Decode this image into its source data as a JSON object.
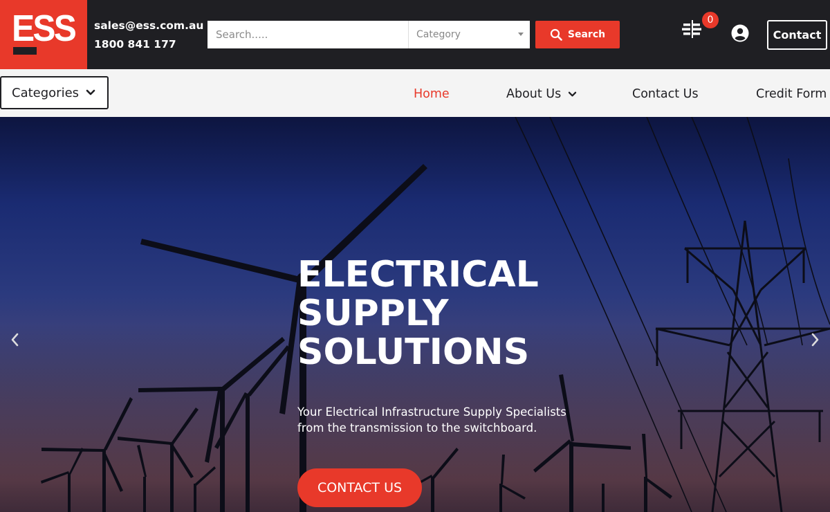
{
  "brand": {
    "logo_text": "ESS",
    "accent_color": "#e8392a",
    "dark_color": "#1f1f23"
  },
  "header": {
    "email": "sales@ess.com.au",
    "phone": "1800 841 177",
    "search_placeholder": "Search.....",
    "category_label": "Category",
    "search_button": "Search",
    "cart_count": "0",
    "contact_button": "Contact"
  },
  "nav": {
    "categories_label": "Categories",
    "items": [
      {
        "label": "Home",
        "active": true
      },
      {
        "label": "About Us",
        "dropdown": true
      },
      {
        "label": "Contact Us"
      },
      {
        "label": "Credit Form"
      }
    ]
  },
  "hero": {
    "title_lines": [
      "ELECTRICAL",
      "SUPPLY",
      "SOLUTIONS"
    ],
    "subtitle_lines": [
      "Your Electrical Infrastructure Supply Specialists",
      "from the transmission to the switchboard."
    ],
    "cta_label": "CONTACT US"
  },
  "icons": {
    "search": "search-icon",
    "compare": "compare-icon",
    "user": "user-icon",
    "chevron": "chevron-down-icon",
    "prev": "chevron-left-icon",
    "next": "chevron-right-icon"
  }
}
